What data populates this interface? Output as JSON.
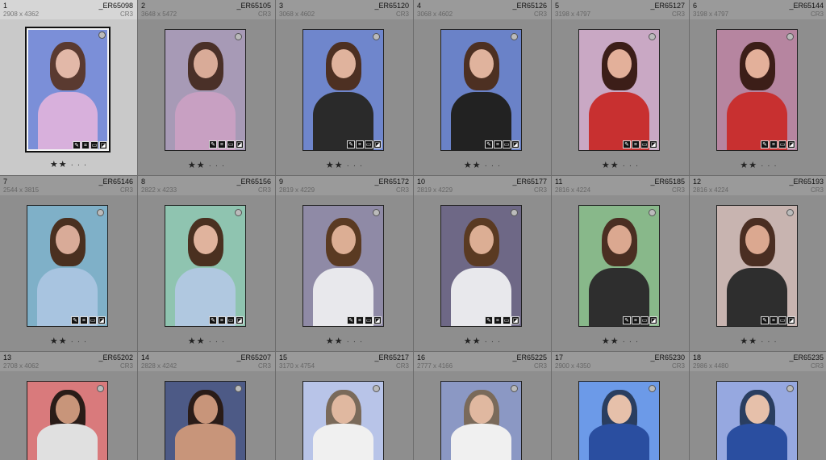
{
  "grid": {
    "cells": [
      {
        "num": "1",
        "dims": "2908 x 4362",
        "file": "_ER65098",
        "ext": "CR3",
        "stars": "★★",
        "dots": "· · ·",
        "selected": true,
        "bg": "#7b8fd8",
        "hair": "#5a3a30",
        "skin": "#e2b8a8",
        "cloth": "#d8b0dc"
      },
      {
        "num": "2",
        "dims": "3648 x 5472",
        "file": "_ER65105",
        "ext": "CR3",
        "stars": "★★",
        "dots": "· · ·",
        "selected": false,
        "bg": "#a79ab6",
        "hair": "#4a3028",
        "skin": "#d9ab98",
        "cloth": "#c8a0c2"
      },
      {
        "num": "3",
        "dims": "3068 x 4602",
        "file": "_ER65120",
        "ext": "CR3",
        "stars": "★★",
        "dots": "· · ·",
        "selected": false,
        "bg": "#6f86cc",
        "hair": "#4d3022",
        "skin": "#e0b39d",
        "cloth": "#2a2a2a"
      },
      {
        "num": "4",
        "dims": "3068 x 4602",
        "file": "_ER65126",
        "ext": "CR3",
        "stars": "★★",
        "dots": "· · ·",
        "selected": false,
        "bg": "#6a82c8",
        "hair": "#4d3022",
        "skin": "#e0b39d",
        "cloth": "#222"
      },
      {
        "num": "5",
        "dims": "3198 x 4797",
        "file": "_ER65127",
        "ext": "CR3",
        "stars": "★★",
        "dots": "· · ·",
        "selected": false,
        "bg": "#c9a8c4",
        "hair": "#3c1e18",
        "skin": "#e3b09a",
        "cloth": "#c83030"
      },
      {
        "num": "6",
        "dims": "3198 x 4797",
        "file": "_ER65144",
        "ext": "CR3",
        "stars": "★★",
        "dots": "· · ·",
        "selected": false,
        "bg": "#b685a0",
        "hair": "#3c1e18",
        "skin": "#e3b09a",
        "cloth": "#c83030"
      },
      {
        "num": "7",
        "dims": "2544 x 3815",
        "file": "_ER65146",
        "ext": "CR3",
        "stars": "★★",
        "dots": "· · ·",
        "selected": false,
        "bg": "#7fb0c8",
        "hair": "#4a3020",
        "skin": "#d9ab98",
        "cloth": "#a8c4e0"
      },
      {
        "num": "8",
        "dims": "2822 x 4233",
        "file": "_ER65156",
        "ext": "CR3",
        "stars": "★★",
        "dots": "· · ·",
        "selected": false,
        "bg": "#8fc4b0",
        "hair": "#4a3020",
        "skin": "#e0b39d",
        "cloth": "#b0c8e0"
      },
      {
        "num": "9",
        "dims": "2819 x 4229",
        "file": "_ER65172",
        "ext": "CR3",
        "stars": "★★",
        "dots": "· · ·",
        "selected": false,
        "bg": "#8f8aa6",
        "hair": "#5a3a22",
        "skin": "#dcae94",
        "cloth": "#e8e8ec"
      },
      {
        "num": "10",
        "dims": "2819 x 4229",
        "file": "_ER65177",
        "ext": "CR3",
        "stars": "★★",
        "dots": "· · ·",
        "selected": false,
        "bg": "#6e6886",
        "hair": "#5a3a22",
        "skin": "#dcae94",
        "cloth": "#e8e8ec"
      },
      {
        "num": "11",
        "dims": "2816 x 4224",
        "file": "_ER65185",
        "ext": "CR3",
        "stars": "★★",
        "dots": "· · ·",
        "selected": false,
        "bg": "#88b88a",
        "hair": "#4a2e22",
        "skin": "#dba890",
        "cloth": "#2e2e2e"
      },
      {
        "num": "12",
        "dims": "2816 x 4224",
        "file": "_ER65193",
        "ext": "CR3",
        "stars": "★★",
        "dots": "· · ·",
        "selected": false,
        "bg": "#c8b4b0",
        "hair": "#4a2e22",
        "skin": "#dba890",
        "cloth": "#2e2e2e"
      },
      {
        "num": "13",
        "dims": "2708 x 4062",
        "file": "_ER65202",
        "ext": "CR3",
        "stars": "",
        "dots": "",
        "selected": false,
        "bg": "#d97a7c",
        "hair": "#2a1c18",
        "skin": "#c8957a",
        "cloth": "#e0e0e0"
      },
      {
        "num": "14",
        "dims": "2828 x 4242",
        "file": "_ER65207",
        "ext": "CR3",
        "stars": "",
        "dots": "",
        "selected": false,
        "bg": "#4d5a86",
        "hair": "#2a1c18",
        "skin": "#c8957a",
        "cloth": "#c8957a"
      },
      {
        "num": "15",
        "dims": "3170 x 4754",
        "file": "_ER65217",
        "ext": "CR3",
        "stars": "",
        "dots": "",
        "selected": false,
        "bg": "#b8c4e8",
        "hair": "#7a6a5a",
        "skin": "#e0b8a0",
        "cloth": "#f0f0f0"
      },
      {
        "num": "16",
        "dims": "2777 x 4166",
        "file": "_ER65225",
        "ext": "CR3",
        "stars": "",
        "dots": "",
        "selected": false,
        "bg": "#8b98c4",
        "hair": "#7a6a5a",
        "skin": "#e0b8a0",
        "cloth": "#f0f0f0"
      },
      {
        "num": "17",
        "dims": "2900 x 4350",
        "file": "_ER65230",
        "ext": "CR3",
        "stars": "",
        "dots": "",
        "selected": false,
        "bg": "#6c9ae8",
        "hair": "#2a3e60",
        "skin": "#e6c0aa",
        "cloth": "#2a4ea0"
      },
      {
        "num": "18",
        "dims": "2986 x 4480",
        "file": "_ER65235",
        "ext": "CR3",
        "stars": "",
        "dots": "",
        "selected": false,
        "bg": "#96a8e0",
        "hair": "#2a3e60",
        "skin": "#e6c0aa",
        "cloth": "#2a4ea0"
      }
    ]
  }
}
